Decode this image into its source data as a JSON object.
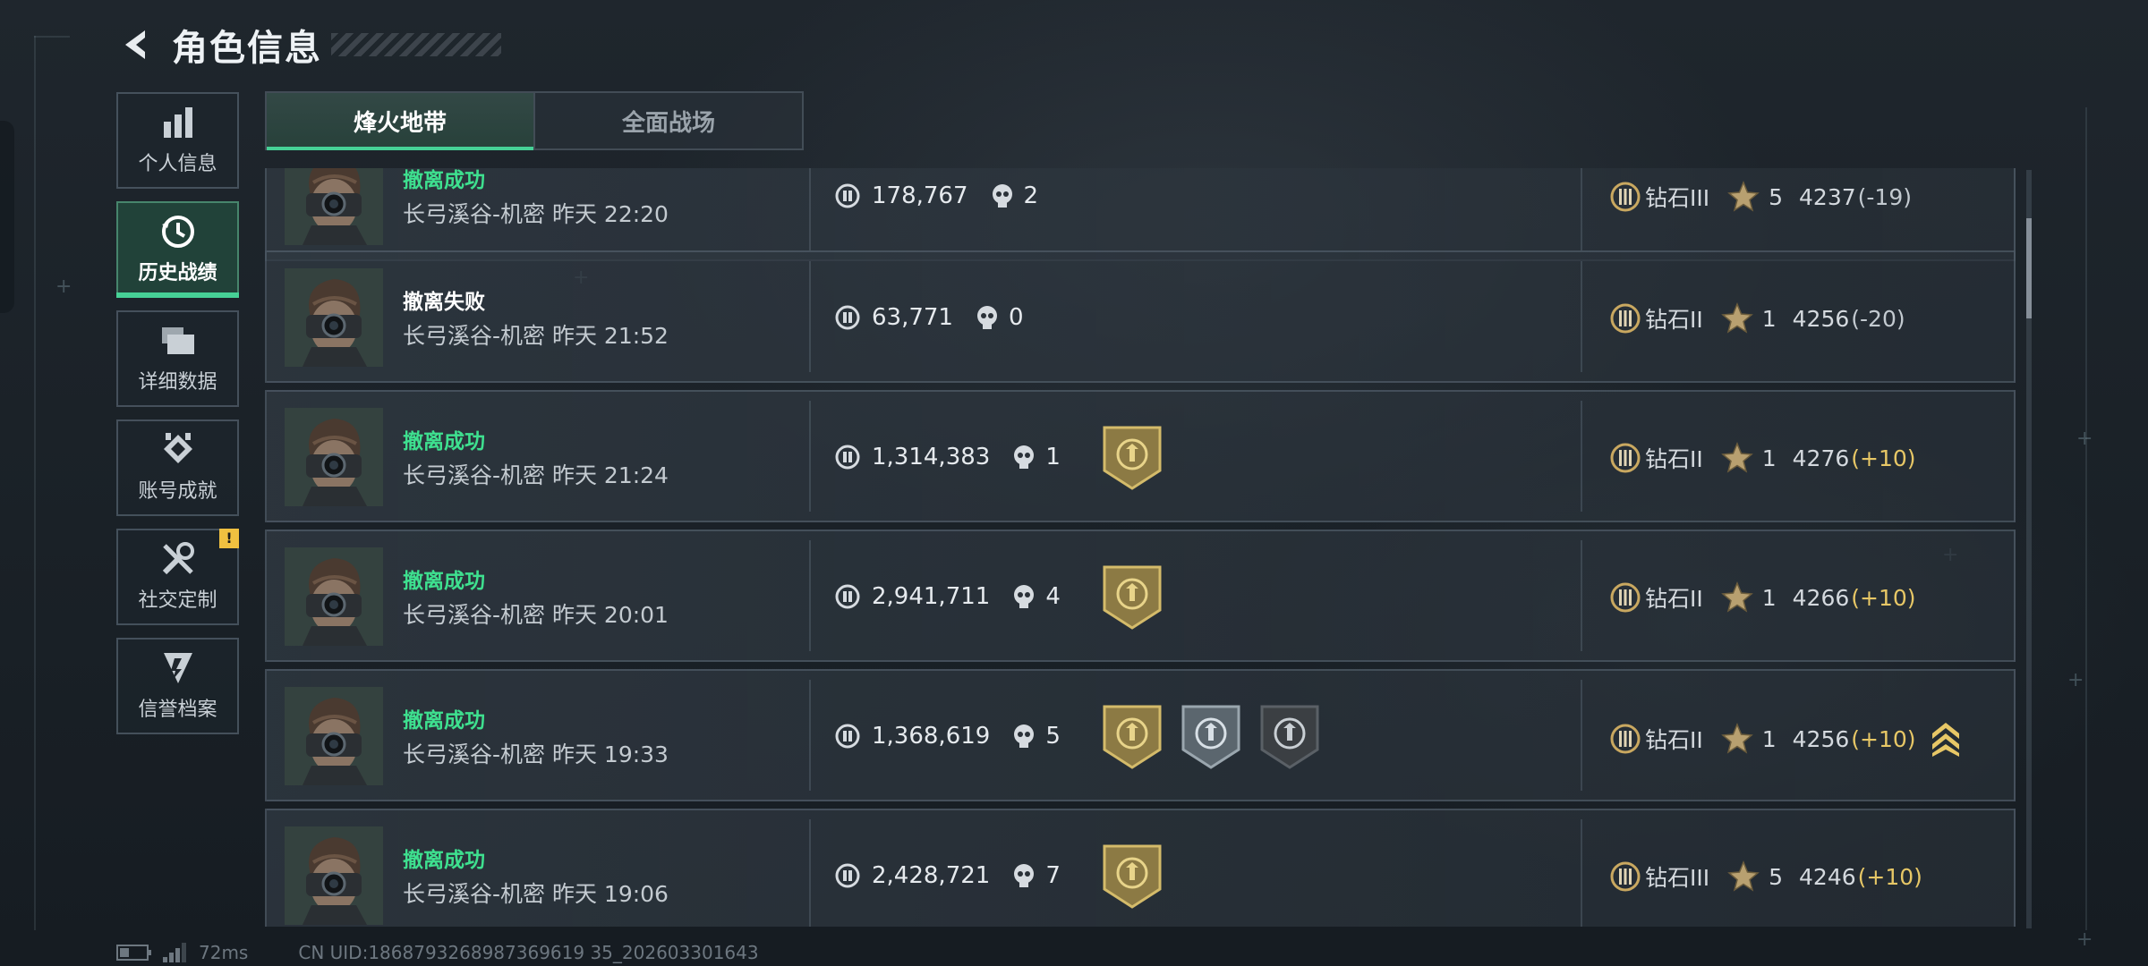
{
  "header": {
    "title": "角色信息"
  },
  "sidebar": {
    "items": [
      {
        "label": "个人信息",
        "icon": "bar-chart-icon"
      },
      {
        "label": "历史战绩",
        "icon": "history-clock-icon",
        "active": true
      },
      {
        "label": "详细数据",
        "icon": "folders-icon"
      },
      {
        "label": "账号成就",
        "icon": "achievement-icon"
      },
      {
        "label": "社交定制",
        "icon": "tools-icon",
        "alert": "!"
      },
      {
        "label": "信誉档案",
        "icon": "credit-shield-icon"
      }
    ]
  },
  "tabs": [
    {
      "label": "烽火地带",
      "active": true
    },
    {
      "label": "全面战场",
      "active": false
    }
  ],
  "records": [
    {
      "result": "撤离成功",
      "success": true,
      "map": "长弓溪谷-机密 昨天 22:20",
      "value": "178,767",
      "kills": "2",
      "badges": [],
      "rank": "钻石III",
      "stars": "5",
      "score": "4237",
      "delta": "(-19)",
      "delta_type": "neg",
      "promotion": false
    },
    {
      "result": "撤离失败",
      "success": false,
      "map": "长弓溪谷-机密 昨天 21:52",
      "value": "63,771",
      "kills": "0",
      "badges": [],
      "rank": "钻石II",
      "stars": "1",
      "score": "4256",
      "delta": "(-20)",
      "delta_type": "neg",
      "promotion": false
    },
    {
      "result": "撤离成功",
      "success": true,
      "map": "长弓溪谷-机密 昨天 21:24",
      "value": "1,314,383",
      "kills": "1",
      "badges": [
        "gold-wreath-badge-icon"
      ],
      "rank": "钻石II",
      "stars": "1",
      "score": "4276",
      "delta": "(+10)",
      "delta_type": "pos",
      "promotion": false
    },
    {
      "result": "撤离成功",
      "success": true,
      "map": "长弓溪谷-机密 昨天 20:01",
      "value": "2,941,711",
      "kills": "4",
      "badges": [
        "gold-wreath-badge-icon"
      ],
      "rank": "钻石II",
      "stars": "1",
      "score": "4266",
      "delta": "(+10)",
      "delta_type": "pos",
      "promotion": false
    },
    {
      "result": "撤离成功",
      "success": true,
      "map": "长弓溪谷-机密 昨天 19:33",
      "value": "1,368,619",
      "kills": "5",
      "badges": [
        "gold-wreath-badge-icon",
        "silver-crosshair-badge-icon",
        "dark-map-badge-icon"
      ],
      "rank": "钻石II",
      "stars": "1",
      "score": "4256",
      "delta": "(+10)",
      "delta_type": "pos",
      "promotion": true
    },
    {
      "result": "撤离成功",
      "success": true,
      "map": "长弓溪谷-机密 昨天 19:06",
      "value": "2,428,721",
      "kills": "7",
      "badges": [
        "gold-wreath-badge-icon"
      ],
      "rank": "钻石III",
      "stars": "5",
      "score": "4246",
      "delta": "(+10)",
      "delta_type": "pos",
      "promotion": false
    }
  ],
  "footer": {
    "ping": "72ms",
    "uid": "CN UID:1868793268987369619 35_202603301643"
  },
  "colors": {
    "success": "#3ee08f",
    "accent": "#46d196",
    "gold": "#e7c766"
  }
}
